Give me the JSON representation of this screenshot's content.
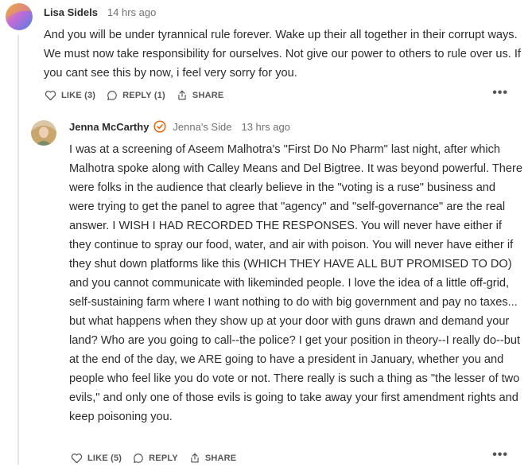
{
  "comments": [
    {
      "author": "Lisa Sidels",
      "time": "14 hrs ago",
      "body": "And you will be under tyrannical rule forever. Wake up their all together in their corrupt ways. We must now take responsibility for ourselves. Not give our power to others to rule over us. If you cant see this by now, i feel very sorry for you.",
      "like_label": "LIKE (3)",
      "reply_label": "REPLY (1)",
      "share_label": "SHARE",
      "more_label": "•••",
      "avatar_icon": "gradient-avatar"
    },
    {
      "author": "Jenna McCarthy",
      "badge_icon": "verified-check-icon",
      "side": "Jenna's Side",
      "time": "13 hrs ago",
      "body": "I was at a screening of Aseem Malhotra's \"First Do No Pharm\" last night, after which Malhotra spoke along with Calley Means and Del Bigtree. It was beyond powerful. There were folks in the audience that clearly believe in the \"voting is a ruse\" business and were trying to get the panel to agree that \"agency\" and \"self-governance\" are the real answer. I WISH I HAD RECORDED THE RESPONSES. You will never have either if they continue to spray our food, water, and air with poison. You will never have either if they shut down platforms like this (WHICH THEY HAVE ALL BUT PROMISED TO DO) and you cannot communicate with likeminded people. I love the idea of a little off-grid, self-sustaining farm where I want nothing to do with big government and pay no taxes... but what happens when they show up at your door with guns drawn and demand your land? Who are you going to call--the police? I get your position in theory--I really do--but at the end of the day, we ARE going to have a president in January, whether you and people who feel like you do vote or not. There really is such a thing as \"the lesser of two evils,\" and only one of those evils is going to take away your first amendment rights and keep poisoning you.",
      "like_label": "LIKE (5)",
      "reply_label": "REPLY",
      "share_label": "SHARE",
      "more_label": "•••",
      "avatar_icon": "photo-avatar"
    }
  ],
  "colors": {
    "accent_orange": "#e8630a",
    "text": "#2b2b2b",
    "muted": "#707070"
  }
}
